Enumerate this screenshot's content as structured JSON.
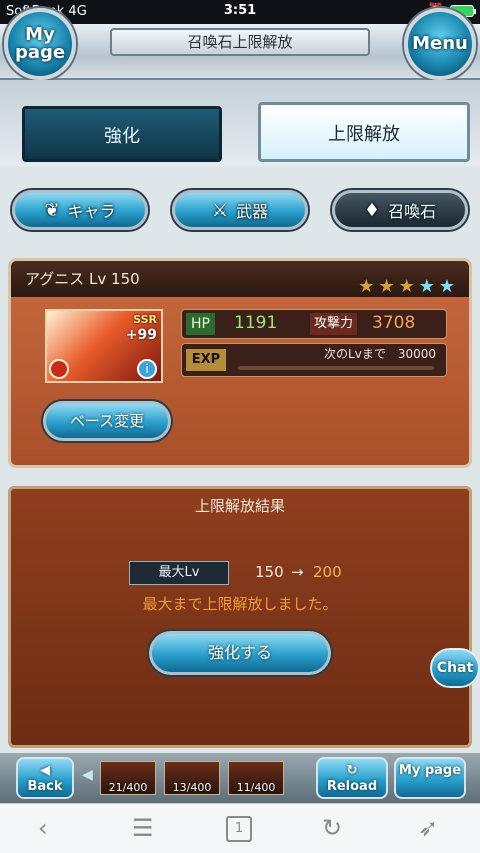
{
  "statusbar": {
    "carrier": "SoftBank 4G",
    "time": "3:51"
  },
  "header": {
    "title": "召喚石上限解放",
    "mypage_label": "My page",
    "menu_label": "Menu"
  },
  "tabs": [
    {
      "label": "強化"
    },
    {
      "label": "上限解放"
    }
  ],
  "subtabs": [
    {
      "label": "キャラ"
    },
    {
      "label": "武器"
    },
    {
      "label": "召喚石"
    }
  ],
  "summon": {
    "name": "アグニス Lv 150",
    "rarity": "SSR",
    "plus": "+99",
    "hp_label": "HP",
    "hp": "1191",
    "atk_label": "攻撃力",
    "atk": "3708",
    "exp_label": "EXP",
    "exp_next": "次のLvまで　30000",
    "exp_progress": 0,
    "stars": [
      "gold",
      "gold",
      "gold",
      "blue",
      "blue"
    ],
    "base_change_label": "ベース変更"
  },
  "result": {
    "heading": "上限解放結果",
    "maxlv_label": "最大Lv",
    "lv_from": "150",
    "arrow": "→",
    "lv_to": "200",
    "message": "最大まで上限解放しました。",
    "enhance_label": "強化する"
  },
  "chat_label": "Chat",
  "gamebar": {
    "back_label": "Back",
    "reload_label": "Reload",
    "mypage_label": "My page",
    "party": [
      {
        "count": "21/400"
      },
      {
        "count": "13/400"
      },
      {
        "count": "11/400"
      }
    ]
  },
  "safari": {
    "tabs_count": "1"
  }
}
